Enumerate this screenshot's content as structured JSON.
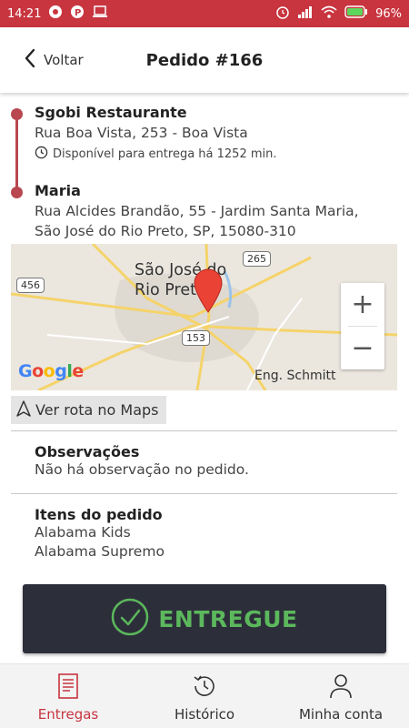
{
  "status_bar": {
    "time": "14:21",
    "battery": "96%",
    "background_color": "#c8353f"
  },
  "header": {
    "back_label": "Voltar",
    "title": "Pedido #166"
  },
  "route": {
    "origin": {
      "name": "Sgobi Restaurante",
      "address": "Rua Boa Vista, 253 - Boa Vista",
      "availability": "Disponível para entrega há 1252 min."
    },
    "destination": {
      "name": "Maria",
      "address_line1": "Rua Alcides Brandão, 55 - Jardim Santa Maria,",
      "address_line2": "São José do Rio Preto, SP, 15080-310"
    },
    "accent_color": "#b8474f"
  },
  "map": {
    "city_line1": "São José do",
    "city_line2": "Rio Preto",
    "place_label": "Eng. Schmitt",
    "route_shields": [
      "456",
      "265",
      "153"
    ],
    "zoom_in": "+",
    "zoom_out": "−",
    "google_logo": "Google"
  },
  "route_button": {
    "label": "Ver rota no Maps"
  },
  "observations": {
    "title": "Observações",
    "text": "Não há observação no pedido."
  },
  "items": {
    "title": "Itens do pedido",
    "list": [
      "Alabama Kids",
      "Alabama Supremo"
    ]
  },
  "action": {
    "delivered_label": "ENTREGUE",
    "button_color": "#2c2f3a",
    "label_color": "#5cb85c"
  },
  "bottom_nav": {
    "items": [
      {
        "label": "Entregas",
        "icon": "list-document-icon",
        "active": true
      },
      {
        "label": "Histórico",
        "icon": "history-clock-icon",
        "active": false
      },
      {
        "label": "Minha conta",
        "icon": "user-icon",
        "active": false
      }
    ]
  }
}
